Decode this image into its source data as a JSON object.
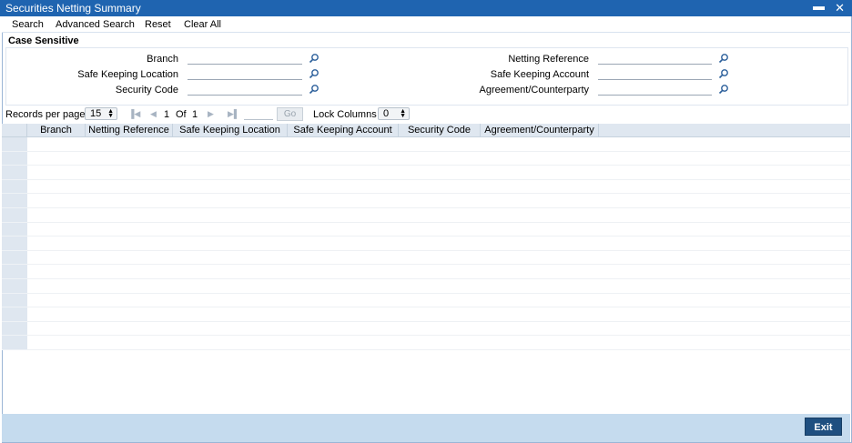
{
  "window": {
    "title": "Securities Netting Summary",
    "minimize_glyph": "▬",
    "close_glyph": "✕"
  },
  "toolbar": {
    "search": "Search",
    "advanced_search": "Advanced Search",
    "reset": "Reset",
    "clear_all": "Clear All"
  },
  "criteria": {
    "case_sensitive": "Case Sensitive",
    "branch": "Branch",
    "safe_keeping_location": "Safe Keeping Location",
    "security_code": "Security Code",
    "netting_reference": "Netting Reference",
    "safe_keeping_account": "Safe Keeping Account",
    "agreement_counterparty": "Agreement/Counterparty"
  },
  "pager": {
    "records_per_page_label": "Records per page",
    "records_per_page_value": "15",
    "current_page": "1",
    "of_label": "Of",
    "total_pages": "1",
    "go_label": "Go",
    "lock_columns_label": "Lock Columns",
    "lock_columns_value": "0"
  },
  "grid": {
    "columns": [
      "Branch",
      "Netting Reference",
      "Safe Keeping Location",
      "Safe Keeping Account",
      "Security Code",
      "Agreement/Counterparty"
    ]
  },
  "footer": {
    "exit_label": "Exit"
  },
  "colors": {
    "title_bar": "#1f64b0",
    "footer": "#c5dbee",
    "exit_button": "#1f4f80"
  }
}
